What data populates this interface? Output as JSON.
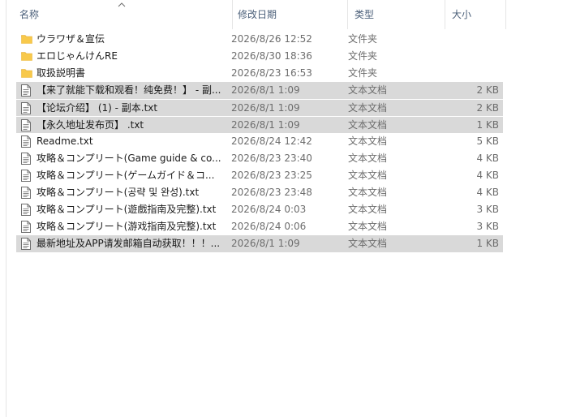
{
  "header": {
    "name": "名称",
    "date": "修改日期",
    "type": "类型",
    "size": "大小"
  },
  "colors": {
    "folder": "#f8c94b",
    "selected_row": "#d9d9d9",
    "header_text": "#4c607a"
  },
  "files": [
    {
      "icon": "folder-icon",
      "name": "ウラワザ＆宣伝",
      "date": "2026/8/26 12:52",
      "type": "文件夹",
      "size": "",
      "selected": false
    },
    {
      "icon": "folder-icon",
      "name": "エロじゃんけんRE",
      "date": "2026/8/30 18:36",
      "type": "文件夹",
      "size": "",
      "selected": false
    },
    {
      "icon": "folder-icon",
      "name": "取扱説明書",
      "date": "2026/8/23 16:53",
      "type": "文件夹",
      "size": "",
      "selected": false
    },
    {
      "icon": "text-file-icon",
      "name": "【来了就能下载和观看！纯免费！】 - 副...",
      "date": "2026/8/1 1:09",
      "type": "文本文档",
      "size": "2 KB",
      "selected": true
    },
    {
      "icon": "text-file-icon",
      "name": "【论坛介绍】 (1) - 副本.txt",
      "date": "2026/8/1 1:09",
      "type": "文本文档",
      "size": "2 KB",
      "selected": true
    },
    {
      "icon": "text-file-icon",
      "name": "【永久地址发布页】 .txt",
      "date": "2026/8/1 1:09",
      "type": "文本文档",
      "size": "1 KB",
      "selected": true
    },
    {
      "icon": "text-file-icon",
      "name": "Readme.txt",
      "date": "2026/8/24 12:42",
      "type": "文本文档",
      "size": "5 KB",
      "selected": false
    },
    {
      "icon": "text-file-icon",
      "name": "攻略＆コンプリート(Game guide & co...",
      "date": "2026/8/23 23:40",
      "type": "文本文档",
      "size": "4 KB",
      "selected": false
    },
    {
      "icon": "text-file-icon",
      "name": "攻略＆コンプリート(ゲームガイド＆コ...",
      "date": "2026/8/23 23:25",
      "type": "文本文档",
      "size": "4 KB",
      "selected": false
    },
    {
      "icon": "text-file-icon",
      "name": "攻略＆コンプリート(공략 및 완성).txt",
      "date": "2026/8/23 23:48",
      "type": "文本文档",
      "size": "4 KB",
      "selected": false
    },
    {
      "icon": "text-file-icon",
      "name": "攻略＆コンプリート(遊戲指南及完整).txt",
      "date": "2026/8/24 0:03",
      "type": "文本文档",
      "size": "3 KB",
      "selected": false
    },
    {
      "icon": "text-file-icon",
      "name": "攻略＆コンプリート(游戏指南及完整).txt",
      "date": "2026/8/24 0:06",
      "type": "文本文档",
      "size": "3 KB",
      "selected": false
    },
    {
      "icon": "text-file-icon",
      "name": "最新地址及APP请发邮箱自动获取！！！...",
      "date": "2026/8/1 1:09",
      "type": "文本文档",
      "size": "1 KB",
      "selected": true
    }
  ]
}
